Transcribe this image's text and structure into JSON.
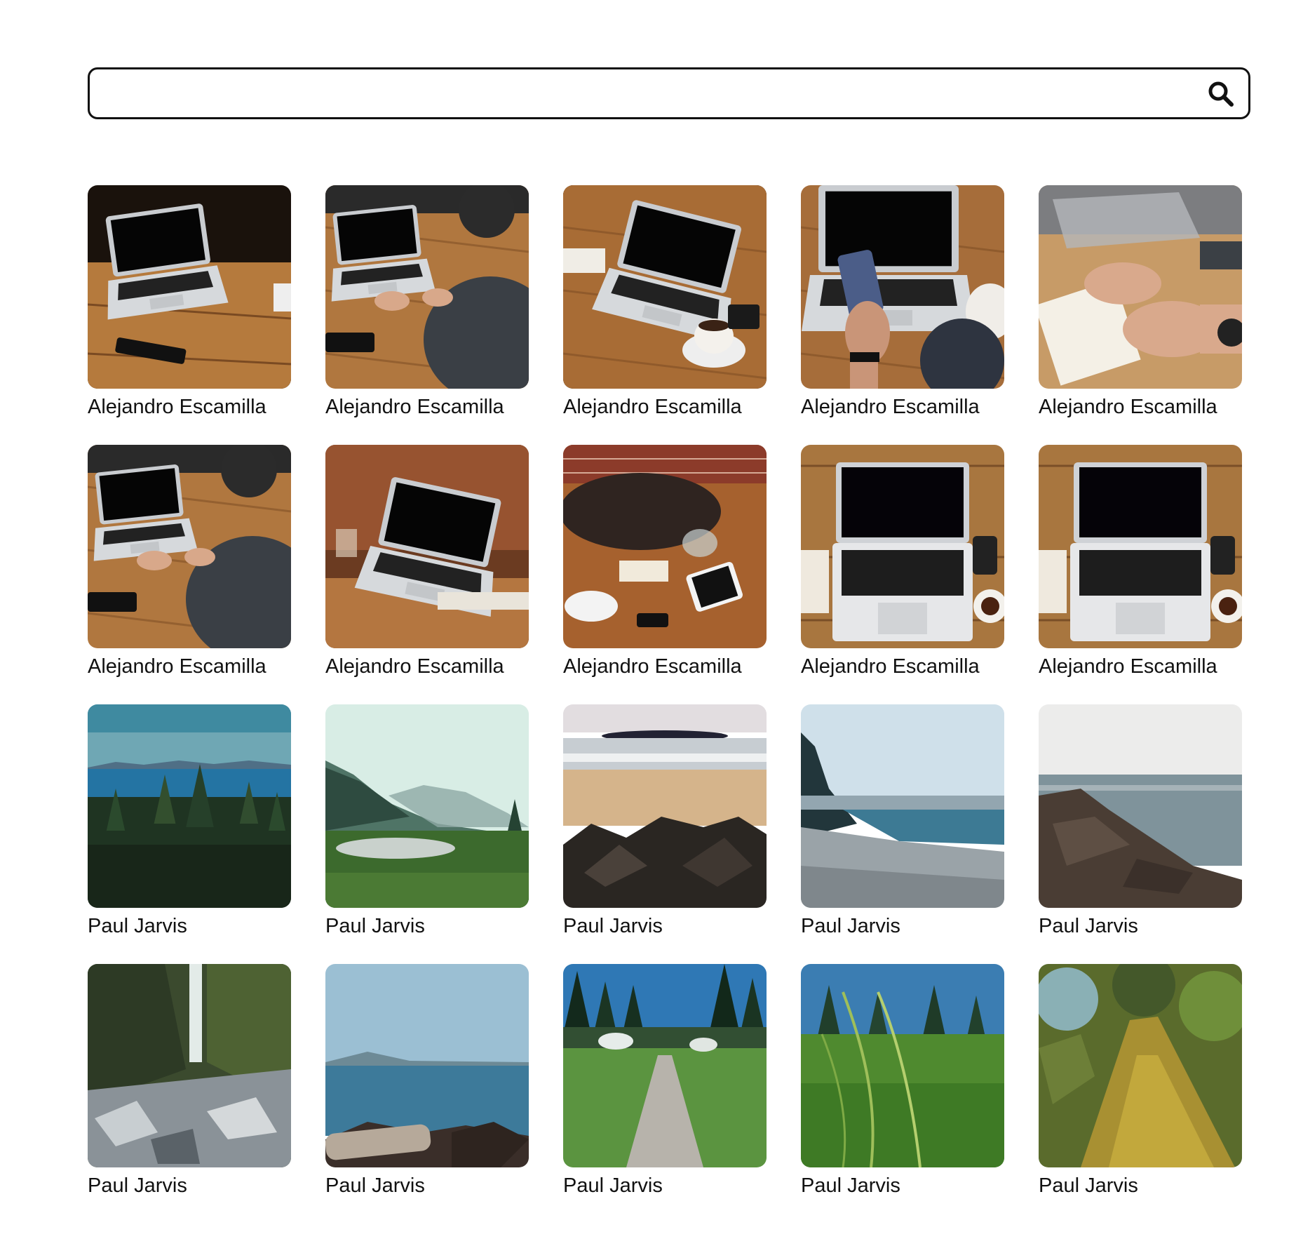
{
  "search": {
    "value": "",
    "placeholder": "",
    "icon": "magnifier-icon"
  },
  "photos": [
    {
      "author": "Alejandro Escamilla",
      "scene": "laptop-on-table"
    },
    {
      "author": "Alejandro Escamilla",
      "scene": "person-typing-laptop"
    },
    {
      "author": "Alejandro Escamilla",
      "scene": "laptop-coffee-cup"
    },
    {
      "author": "Alejandro Escamilla",
      "scene": "hand-holding-phone"
    },
    {
      "author": "Alejandro Escamilla",
      "scene": "hand-writing-notebook"
    },
    {
      "author": "Alejandro Escamilla",
      "scene": "person-typing-laptop"
    },
    {
      "author": "Alejandro Escamilla",
      "scene": "laptop-side-view"
    },
    {
      "author": "Alejandro Escamilla",
      "scene": "bag-and-tablet"
    },
    {
      "author": "Alejandro Escamilla",
      "scene": "laptop-top-down"
    },
    {
      "author": "Alejandro Escamilla",
      "scene": "laptop-top-down"
    },
    {
      "author": "Paul Jarvis",
      "scene": "forest-over-sea"
    },
    {
      "author": "Paul Jarvis",
      "scene": "misty-valley-river"
    },
    {
      "author": "Paul Jarvis",
      "scene": "beach-rocks"
    },
    {
      "author": "Paul Jarvis",
      "scene": "pebble-shore"
    },
    {
      "author": "Paul Jarvis",
      "scene": "rocky-coast"
    },
    {
      "author": "Paul Jarvis",
      "scene": "waterfall"
    },
    {
      "author": "Paul Jarvis",
      "scene": "sea-with-logs"
    },
    {
      "author": "Paul Jarvis",
      "scene": "forest-path"
    },
    {
      "author": "Paul Jarvis",
      "scene": "grass-field"
    },
    {
      "author": "Paul Jarvis",
      "scene": "mossy-tree-trunk"
    }
  ],
  "colors": {
    "text": "#111111",
    "border": "#111111",
    "background": "#ffffff"
  }
}
